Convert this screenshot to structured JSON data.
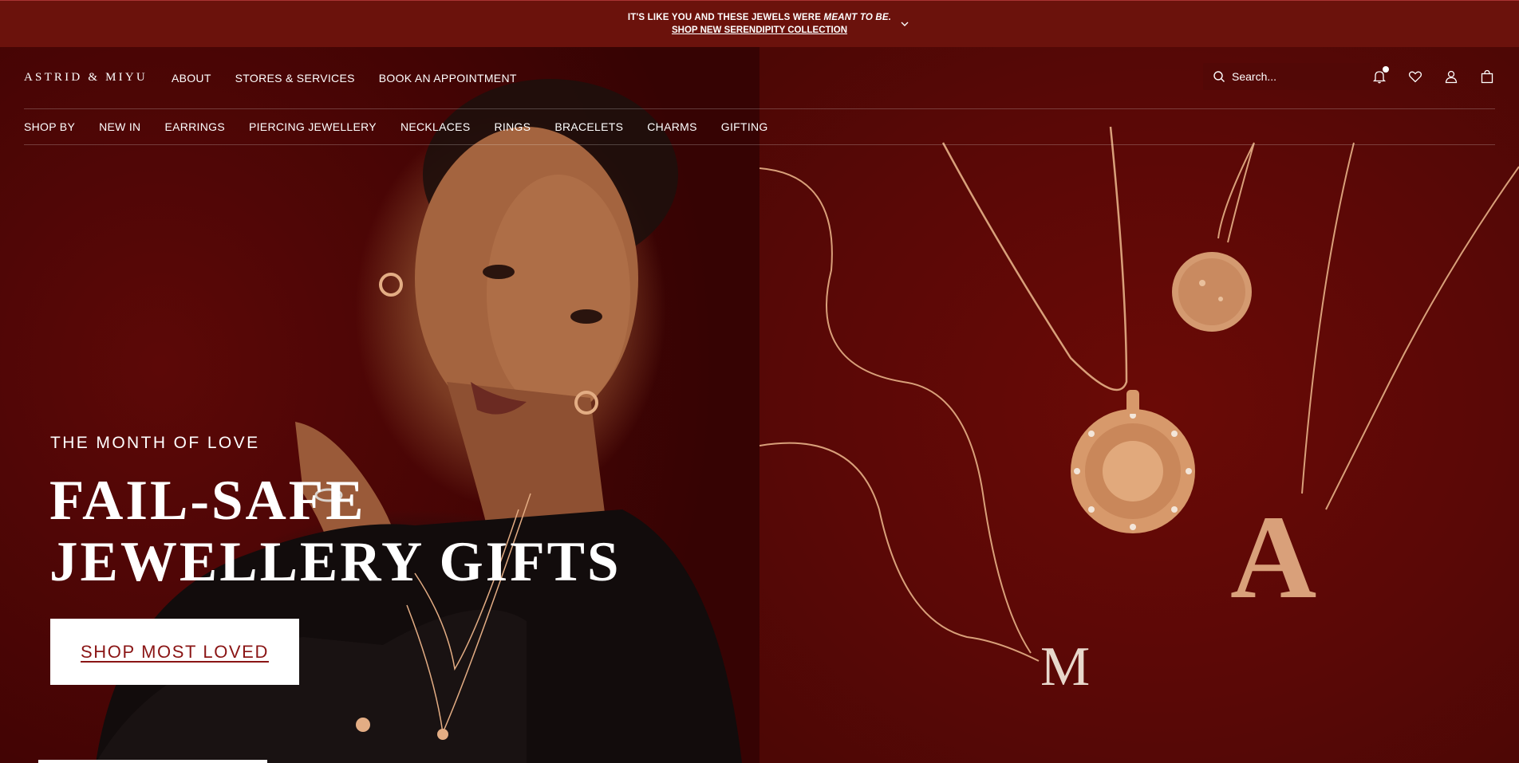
{
  "announcement": {
    "line1_main": "IT'S LIKE YOU AND THESE JEWELS WERE ",
    "line1_emphasis": "MEANT TO BE.",
    "line2_link": "SHOP NEW SERENDIPITY COLLECTION"
  },
  "header": {
    "logo": "ASTRID & MIYU",
    "top_nav": [
      "ABOUT",
      "STORES & SERVICES",
      "BOOK AN APPOINTMENT"
    ],
    "search_placeholder": "Search...",
    "icons": [
      "bell-icon",
      "heart-icon",
      "user-icon",
      "bag-icon"
    ]
  },
  "category_nav": [
    "SHOP BY",
    "NEW IN",
    "EARRINGS",
    "PIERCING JEWELLERY",
    "NECKLACES",
    "RINGS",
    "BRACELETS",
    "CHARMS",
    "GIFTING"
  ],
  "hero": {
    "eyebrow": "THE MONTH OF LOVE",
    "headline_line1": "FAIL-SAFE",
    "headline_line2": "JEWELLERY GIFTS",
    "cta": "SHOP MOST LOVED",
    "pendant_letter_1": "M",
    "pendant_letter_2": "A"
  },
  "colors": {
    "announcement_bg": "#6b120c",
    "hero_bg": "#5a0806",
    "cta_text": "#8a1515",
    "gold": "#e3ad84"
  }
}
